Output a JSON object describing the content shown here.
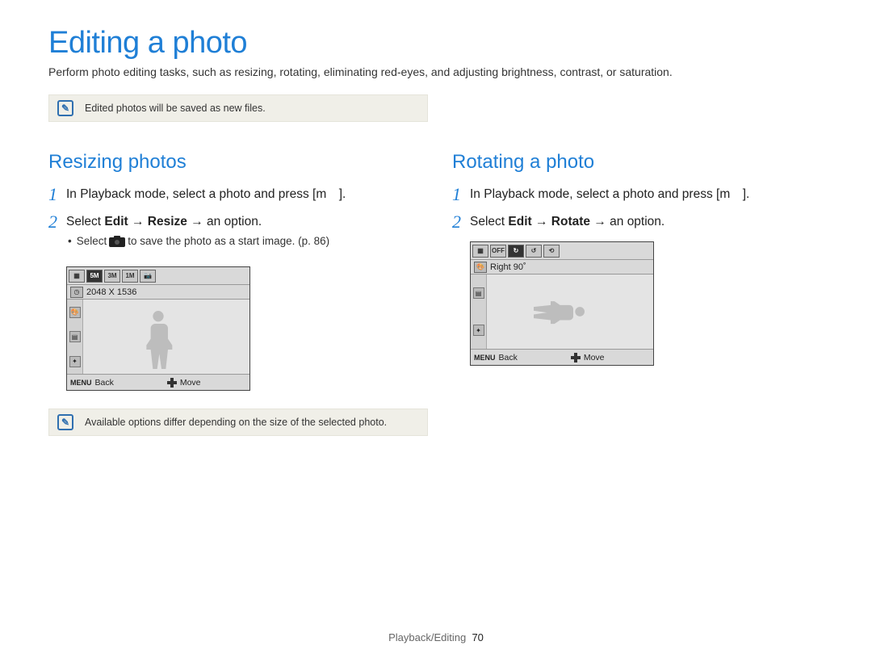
{
  "title": "Editing a photo",
  "intro": "Perform photo editing tasks, such as resizing, rotating, eliminating red-eyes, and adjusting brightness, contrast, or saturation.",
  "note1": "Edited photos will be saved as new files.",
  "left": {
    "heading": "Resizing photos",
    "step1": "In Playback mode, select a photo and press [m ].",
    "step2_pre": "Select ",
    "step2_b1": "Edit",
    "step2_arrow": " → ",
    "step2_b2": "Resize",
    "step2_post": " → an option.",
    "sub1_pre": "Select ",
    "sub1_post": " to save the photo as a start image. (p. 86)",
    "thumb": {
      "top_options": [
        "5M",
        "3M",
        "1M",
        ""
      ],
      "label": "2048 X 1536",
      "back_label": "Back",
      "move_label": "Move",
      "menu_label": "MENU"
    },
    "note2": "Available options differ depending on the size of the selected photo."
  },
  "right": {
    "heading": "Rotating a photo",
    "step1": "In Playback mode, select a photo and press [m ].",
    "step2_pre": "Select ",
    "step2_b1": "Edit",
    "step2_arrow": " → ",
    "step2_b2": "Rotate",
    "step2_post": " → an option.",
    "thumb": {
      "label": "Right 90˚",
      "back_label": "Back",
      "move_label": "Move",
      "menu_label": "MENU"
    }
  },
  "footer_section": "Playback/Editing",
  "footer_page": "70"
}
